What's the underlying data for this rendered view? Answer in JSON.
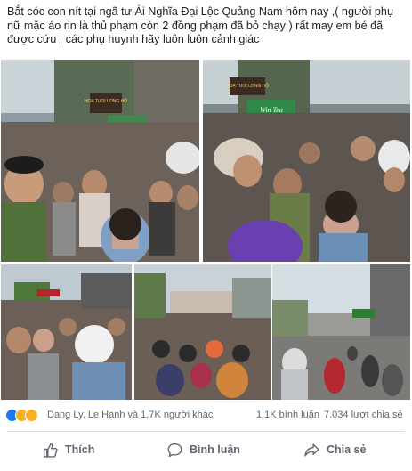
{
  "post": {
    "text": "Bắt cóc con nít tại ngã tư Ái Nghĩa Đại Lộc Quảng Nam hôm nay ,( người phụ nữ mặc áo rin là thủ phạm còn 2 đồng phạm đã bỏ chạy ) rất may em bé đã được cứu , các phụ huynh hãy luôn luôn cảnh giác"
  },
  "photos": {
    "sign1": "HOA TUOI LONG HỘ",
    "sign2": "HOA TUOI LONG HỘ",
    "banner": "Win Tea"
  },
  "stats": {
    "reactions": [
      "like",
      "haha",
      "wow"
    ],
    "reactors": "Dang Ly, Le Hanh và 1,7K người khác",
    "comments": "1,1K bình luận",
    "shares": "7.034 lượt chia sẻ"
  },
  "actions": {
    "like": "Thích",
    "comment": "Bình luận",
    "share": "Chia sẻ"
  },
  "colors": {
    "text": "#1c1e21",
    "meta": "#606770",
    "like_blue": "#1877f2",
    "reaction_yellow": "#f7b125",
    "divider": "#dadde1"
  }
}
